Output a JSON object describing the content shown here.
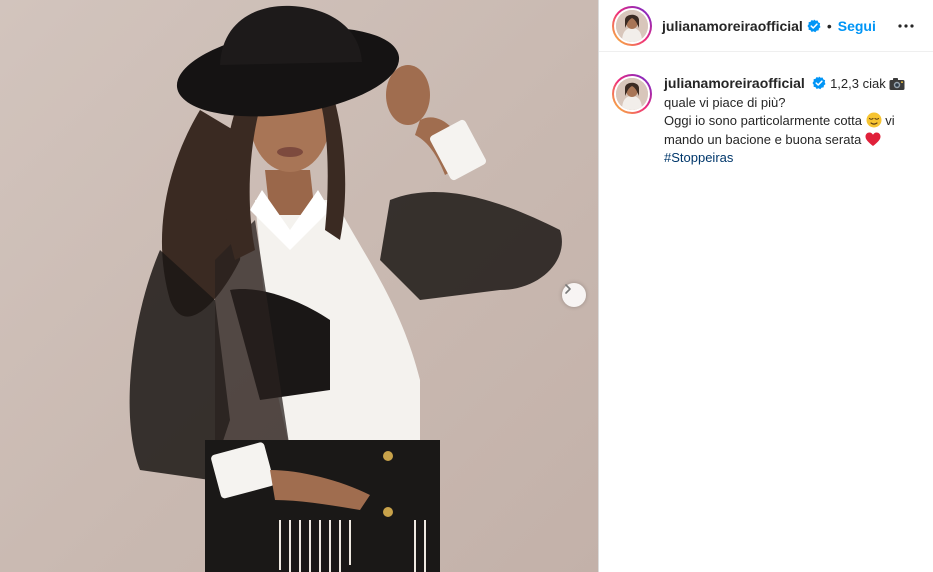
{
  "post": {
    "author": {
      "username": "julianamoreiraofficial",
      "verified": true
    },
    "follow_label": "Segui",
    "separator": "•",
    "caption": {
      "text_part1": "1,2,3 ciak",
      "text_part2": "quale vi piace di più?",
      "text_part3": "Oggi io sono particolarmente cotta",
      "text_part4": "vi",
      "text_part5": "mando un bacione e buona serata",
      "hashtag": "#Stoppeiras"
    },
    "icons": {
      "camera": "camera-icon",
      "sleepy_face": "sleepy-face-emoji",
      "heart": "red-heart-emoji",
      "next": "chevron-right-icon",
      "more": "more-options-icon",
      "verified": "verified-badge-icon"
    },
    "colors": {
      "follow": "#0095f6",
      "hashtag": "#00376b",
      "verified": "#0095f6",
      "text": "#262626",
      "photo_background": "#c9b9b1"
    }
  }
}
